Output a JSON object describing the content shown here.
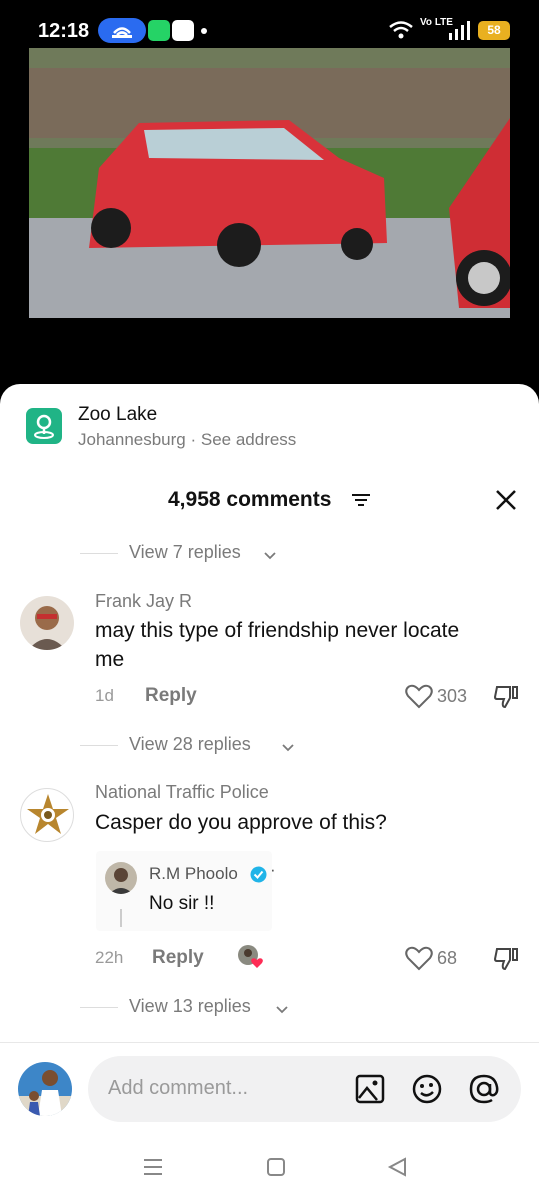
{
  "status_bar": {
    "time": "12:18",
    "network_label": "Vo LTE",
    "battery": "58"
  },
  "location": {
    "name": "Zoo Lake",
    "subtitle": "Johannesburg · See address"
  },
  "comments_header": {
    "count_label": "4,958 comments"
  },
  "comments": [
    {
      "view_replies": "View 7 replies"
    },
    {
      "author": "Frank Jay R",
      "text_line1": "may this type of friendship never locate",
      "text_line2": "me",
      "time": "1d",
      "reply_label": "Reply",
      "likes": "303",
      "view_replies": "View 28 replies"
    },
    {
      "author": "National Traffic Police",
      "text": "Casper do you approve of this?",
      "quoted_author": "R.M Phoolo",
      "quoted_text": "No sir !!",
      "time": "22h",
      "reply_label": "Reply",
      "likes": "68",
      "view_replies": "View 13 replies"
    }
  ],
  "composer": {
    "placeholder": "Add comment..."
  },
  "icons": {
    "location": "location-pin-icon",
    "filter": "filter-icon",
    "close": "close-icon",
    "like": "heart-icon",
    "dislike": "dislike-icon",
    "image": "image-icon",
    "emoji": "emoji-icon",
    "mention": "mention-icon"
  },
  "colors": {
    "accent_blue": "#2a6bf0",
    "location_green": "#20b486",
    "verified": "#20b4e8",
    "battery": "#e9b020"
  }
}
